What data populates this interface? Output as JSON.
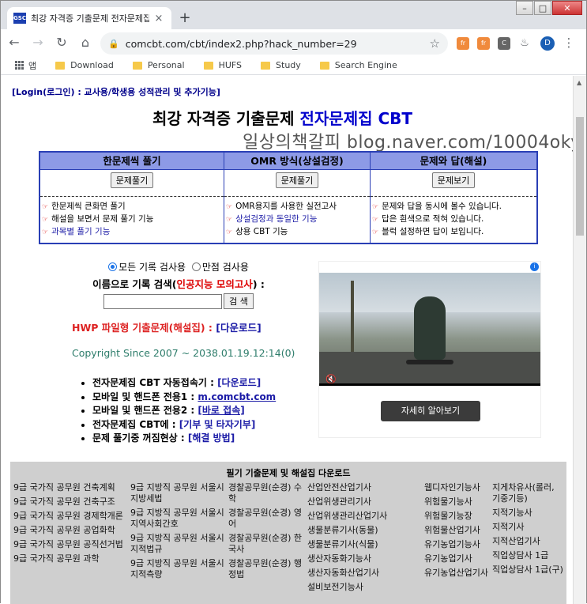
{
  "browser": {
    "tab_title": "최강 자격증 기출문제 전자문제집",
    "tab_close": "×",
    "new_tab": "+",
    "favicon_text": "GSC",
    "url": "comcbt.com/cbt/index2.php?hack_number=29",
    "avatar_letter": "D",
    "window_controls": {
      "minimize": "–",
      "maximize": "□",
      "close": "✕"
    },
    "extensions": [
      "ext-orange-1",
      "ext-orange-2",
      "ext-gray-c",
      "puzzle-icon"
    ],
    "bookmarks": [
      "앱",
      "Download",
      "Personal",
      "HUFS",
      "Study",
      "Search Engine"
    ]
  },
  "page": {
    "login_link": "[Login(로그인) : 교사용/학생용 성적관리 및 추가기능]",
    "title_black": "최강 자격증 기출문제 ",
    "title_blue": "전자문제집 CBT",
    "watermark": "일상의책갈피 blog.naver.com/10004oky",
    "modes": [
      {
        "header": "한문제씩 풀기",
        "button": "문제풀기",
        "features": [
          "한문제씩 큰화면 풀기",
          "해설을 보면서 문제 풀기 기능",
          "과목별 풀기 기능"
        ]
      },
      {
        "header": "OMR 방식(상설검정)",
        "button": "문제풀기",
        "features": [
          "OMR용지를 사용한 실전고사",
          "상설검정과 동일한 기능",
          "상용 CBT 기능"
        ]
      },
      {
        "header": "문제와 답(해설)",
        "button": "문제보기",
        "features": [
          "문제와 답을 동시에 볼수 있습니다.",
          "답은 흰색으로 적혀 있습니다.",
          "블럭 설정하면 답이 보입니다."
        ]
      }
    ],
    "search": {
      "radio_all": "모든 기록 검사용",
      "radio_full": "만점 검사용",
      "label_prefix": "이름으로 기록 검색(",
      "label_red": "인공지능 모의고사",
      "label_suffix": ") :",
      "button": "검 색",
      "input_value": ""
    },
    "hwp": {
      "text": "HWP 파일형 기출문제(해설집) : ",
      "link": "[다운로드]"
    },
    "copyright": "Copyright Since 2007 ~ 2038.01.19.12:14(0)",
    "links": [
      {
        "text": "전자문제집 CBT 자동접속기 : ",
        "link": "[다운로드]"
      },
      {
        "text": "모바일 및 핸드폰 전용1 : ",
        "link": "m.comcbt.com"
      },
      {
        "text": "모바일 및 핸드폰 전용2 : ",
        "link": "[바로 접속]"
      },
      {
        "text": "전자문제집 CBT에 : ",
        "link": "[기부 및 타자기부]"
      },
      {
        "text": "문제 풀기중 꺼짐현상 : ",
        "link": "[해결 방법]"
      }
    ],
    "ad": {
      "button": "자세히 알아보기",
      "info": "i",
      "mute": "🔇"
    },
    "downloads": {
      "title": "필기 기출문제 및 해설집 다운로드",
      "col1": [
        "9급 국가직 공무원 건축계획",
        "9급 국가직 공무원 건축구조",
        "9급 국가직 공무원 경제학개론",
        "9급 국가직 공무원 공업화학",
        "9급 국가직 공무원 공직선거법",
        "9급 국가직 공무원 과학"
      ],
      "col2": [
        "9급 지방직 공무원 서울시 지방세법",
        "9급 지방직 공무원 서울시 지역사회간호",
        "9급 지방직 공무원 서울시 지적법규",
        "9급 지방직 공무원 서울시 지적측량"
      ],
      "col3": [
        "경찰공무원(순경) 수학",
        "경찰공무원(순경) 영어",
        "경찰공무원(순경) 한국사",
        "경찰공무원(순경) 행정법"
      ],
      "col4": [
        "산업안전산업기사",
        "산업위생관리기사",
        "산업위생관리산업기사",
        "생물분류기사(동물)",
        "생물분류기사(식물)",
        "생산자동화기능사",
        "생산자동화산업기사",
        "설비보전기능사"
      ],
      "col5": [
        "웹디자인기능사",
        "위험물기능사",
        "위험물기능장",
        "위험물산업기사",
        "유기농업기능사",
        "유기농업기사",
        "유기농업산업기사"
      ],
      "col6": [
        "지게차유사(롤러, 기중기등)",
        "지적기능사",
        "지적기사",
        "지적산업기사",
        "직업상담사 1급",
        "직업상담사 1급(구)"
      ]
    }
  }
}
